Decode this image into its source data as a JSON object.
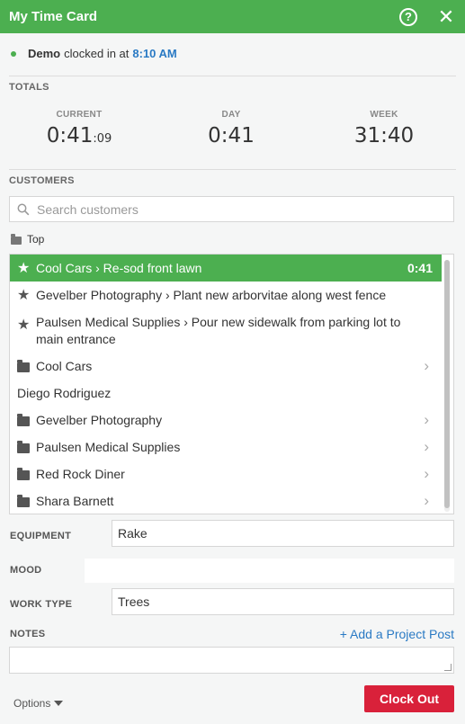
{
  "header": {
    "title": "My Time Card",
    "help_glyph": "?",
    "close_glyph": "✕"
  },
  "status": {
    "user": "Demo",
    "message": "clocked in at",
    "time": "8:10 AM"
  },
  "totals": {
    "label": "TOTALS",
    "current": {
      "label": "CURRENT",
      "value": "0:41",
      "seconds": ":09"
    },
    "day": {
      "label": "DAY",
      "value": "0:41"
    },
    "week": {
      "label": "WEEK",
      "value": "31:40"
    }
  },
  "customers": {
    "label": "CUSTOMERS",
    "search_placeholder": "Search customers",
    "breadcrumb": "Top",
    "items": [
      {
        "label": "Cool Cars › Re-sod front lawn",
        "time": "0:41",
        "icon": "star-icon",
        "active": true
      },
      {
        "label": "Gevelber Photography › Plant new arborvitae along west fence",
        "icon": "star-icon"
      },
      {
        "label": "Paulsen Medical Supplies › Pour new sidewalk from parking lot to main entrance",
        "icon": "star-icon"
      },
      {
        "label": "Cool Cars",
        "icon": "folder-icon",
        "chevron": "›"
      },
      {
        "label": "Diego Rodriguez",
        "icon": "none"
      },
      {
        "label": "Gevelber Photography",
        "icon": "folder-icon",
        "chevron": "›"
      },
      {
        "label": "Paulsen Medical Supplies",
        "icon": "folder-icon",
        "chevron": "›"
      },
      {
        "label": "Red Rock Diner",
        "icon": "folder-icon",
        "chevron": "›"
      },
      {
        "label": "Shara Barnett",
        "icon": "folder-icon",
        "chevron": "›"
      }
    ]
  },
  "fields": {
    "equipment": {
      "label": "EQUIPMENT",
      "value": "Rake"
    },
    "mood": {
      "label": "MOOD",
      "value": ""
    },
    "work_type": {
      "label": "WORK TYPE",
      "value": "Trees"
    },
    "notes": {
      "label": "NOTES",
      "value": ""
    }
  },
  "add_post_link": "+ Add a Project Post",
  "options_label": "Options",
  "clock_out_label": "Clock Out",
  "colors": {
    "header": "#4caf50",
    "active_row": "#4caf50",
    "link": "#2a7ac4",
    "clock_out": "#d9213a"
  }
}
